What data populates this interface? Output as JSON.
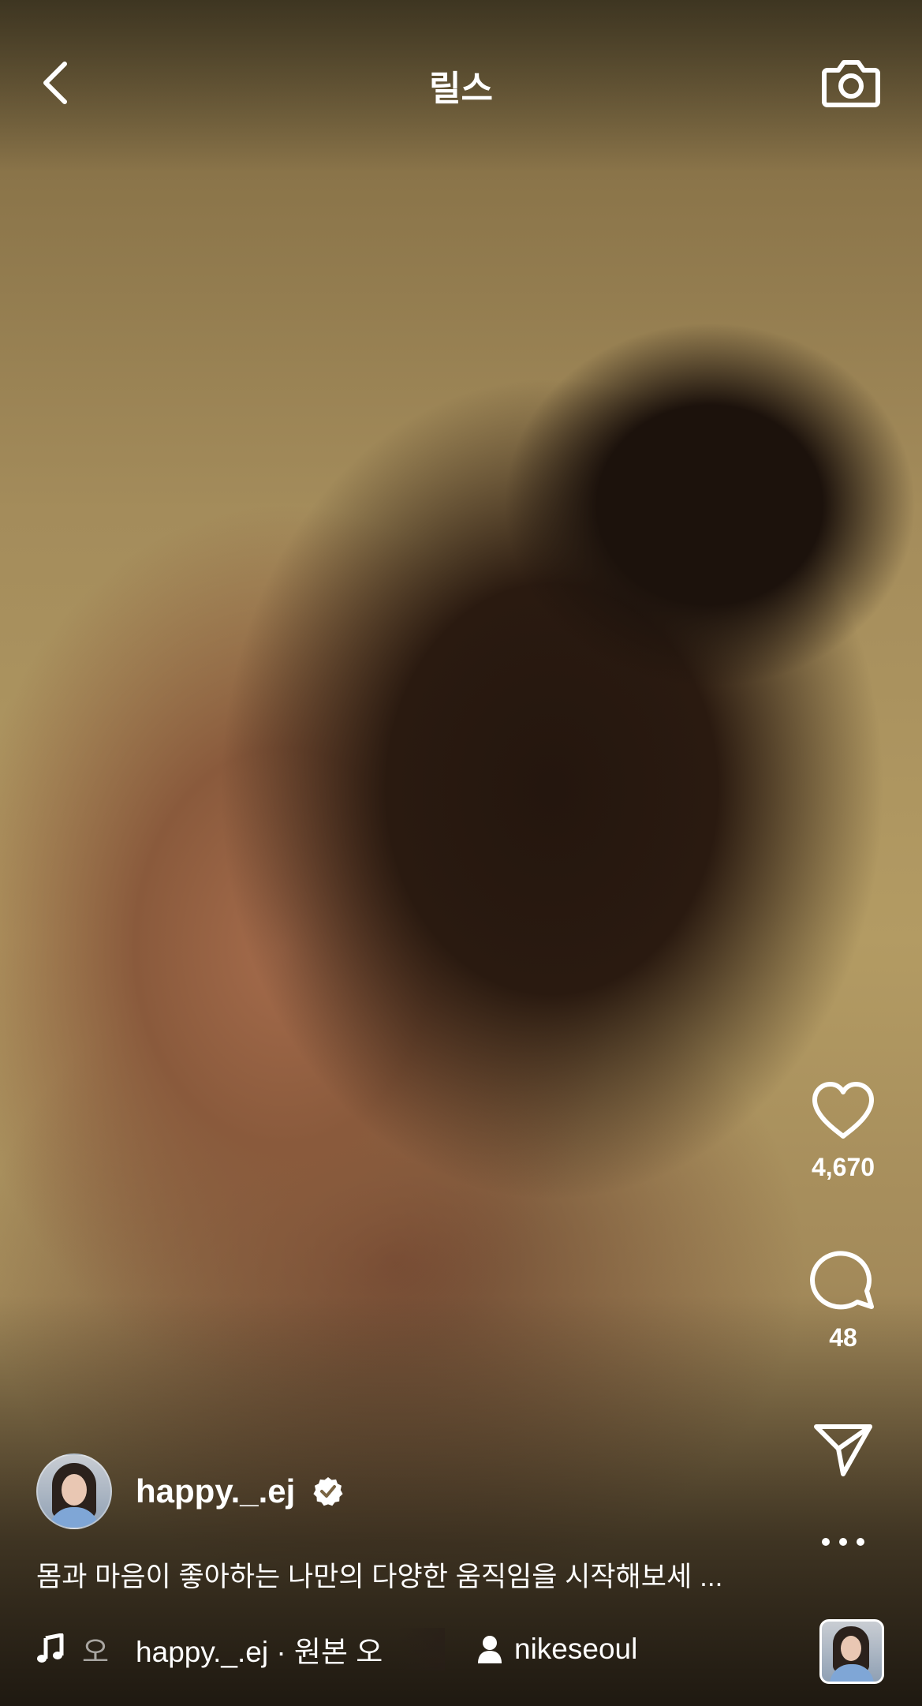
{
  "header": {
    "title": "릴스"
  },
  "icons": {
    "back": "chevron-left-icon",
    "camera": "camera-icon",
    "like": "heart-icon",
    "comment": "comment-bubble-icon",
    "share": "paper-plane-icon",
    "more": "more-horizontal-icon",
    "music": "music-note-icon",
    "verified": "verified-badge-icon",
    "person": "person-icon"
  },
  "actions": {
    "likes": "4,670",
    "comments": "48"
  },
  "post": {
    "username": "happy._.ej",
    "caption": "몸과 마음이 좋아하는 나만의 다양한 움직임을 시작해보세",
    "caption_more": "...",
    "audio_lead": "오",
    "audio_text": "happy._.ej · 원본 오",
    "tagged_user": "nikeseoul"
  },
  "colors": {
    "text": "#ffffff",
    "verified_badge": "#ffffff"
  }
}
